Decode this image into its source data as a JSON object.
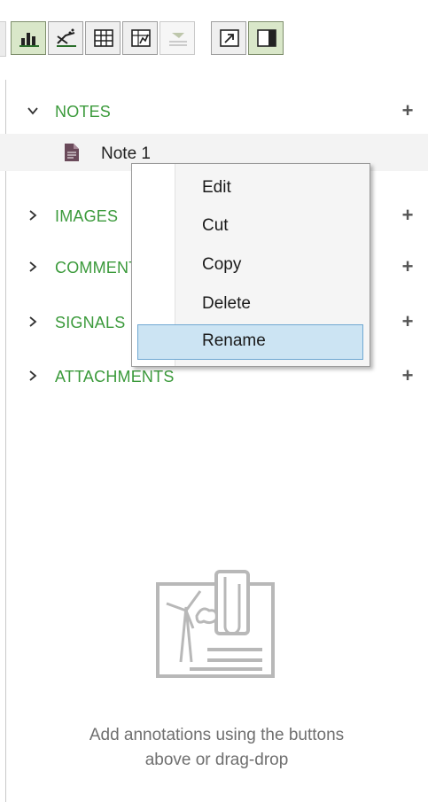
{
  "toolbar": {
    "buttons": [
      {
        "name": "bar-chart-view",
        "icon": "bar-chart-icon",
        "pressed": true
      },
      {
        "name": "curve-fit-view",
        "icon": "curve-icon",
        "pressed": false
      },
      {
        "name": "table-view",
        "icon": "table-icon",
        "pressed": false
      },
      {
        "name": "plot-view",
        "icon": "plot-icon",
        "pressed": false
      },
      {
        "name": "annotation-view",
        "icon": "annotation-icon",
        "pressed": false,
        "disabled": true
      },
      {
        "name": "popout",
        "icon": "popout-icon",
        "pressed": false
      },
      {
        "name": "side-panel",
        "icon": "side-panel-icon",
        "pressed": true
      }
    ]
  },
  "tree": {
    "sections": [
      {
        "label": "NOTES",
        "expanded": true
      },
      {
        "label": "IMAGES",
        "expanded": false
      },
      {
        "label": "COMMENTS",
        "expanded": false
      },
      {
        "label": "SIGNALS",
        "expanded": false
      },
      {
        "label": "ATTACHMENTS",
        "expanded": false
      }
    ],
    "notes": [
      {
        "label": "Note 1"
      }
    ]
  },
  "context_menu": {
    "items": [
      {
        "label": "Edit"
      },
      {
        "label": "Cut"
      },
      {
        "label": "Copy"
      },
      {
        "label": "Delete"
      },
      {
        "label": "Rename",
        "highlighted": true
      }
    ]
  },
  "empty_state": {
    "line1": "Add annotations using the buttons",
    "line2": "above or drag-drop"
  },
  "colors": {
    "section_label": "#3b9a3b",
    "pressed_button": "#d9e7c9",
    "menu_highlight": "#cce4f3"
  }
}
